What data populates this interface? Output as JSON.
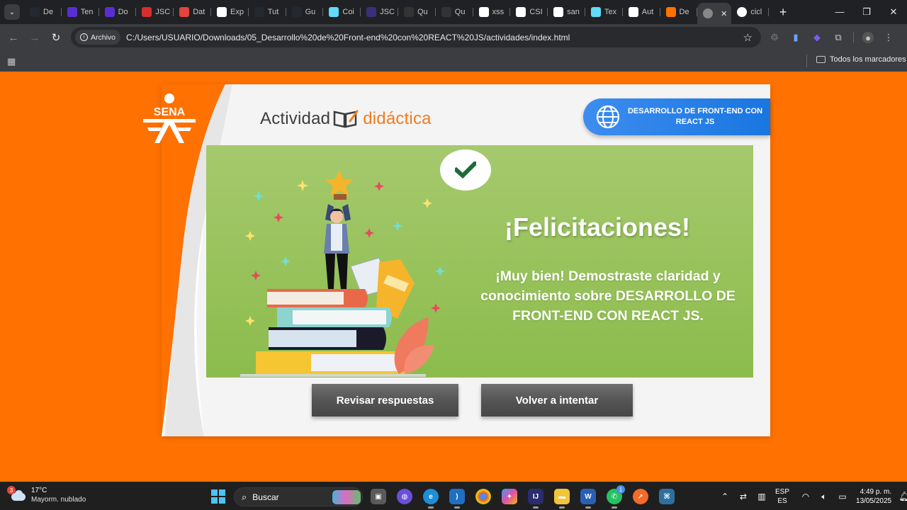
{
  "browser": {
    "tabs": [
      {
        "label": "De",
        "icon": "github-icon",
        "color": "#24292f"
      },
      {
        "label": "Ten",
        "icon": "quill-icon",
        "color": "#5a2fd1"
      },
      {
        "label": "Do",
        "icon": "quill-icon",
        "color": "#5a2fd1"
      },
      {
        "label": "JSC",
        "icon": "linkedin-learning-icon",
        "color": "#d62e2e"
      },
      {
        "label": "Dat",
        "icon": "laravel-icon",
        "color": "#e5443a"
      },
      {
        "label": "Exp",
        "icon": "angular-icon",
        "color": "#ffffff"
      },
      {
        "label": "Tut",
        "icon": "github-icon",
        "color": "#24292f"
      },
      {
        "label": "Gu",
        "icon": "github-icon",
        "color": "#24292f"
      },
      {
        "label": "Coi",
        "icon": "react-icon",
        "color": "#61dafb"
      },
      {
        "label": "JSC",
        "icon": "obs-icon",
        "color": "#3b2f7a"
      },
      {
        "label": "Qu",
        "icon": "book-icon",
        "color": "#333333"
      },
      {
        "label": "Qu",
        "icon": "book-icon",
        "color": "#333333"
      },
      {
        "label": "xss",
        "icon": "google-icon",
        "color": "#ffffff"
      },
      {
        "label": "CSI",
        "icon": "google-icon",
        "color": "#ffffff"
      },
      {
        "label": "san",
        "icon": "google-icon",
        "color": "#ffffff"
      },
      {
        "label": "Tex",
        "icon": "react-icon",
        "color": "#61dafb"
      },
      {
        "label": "Aut",
        "icon": "medium-icon",
        "color": "#ffffff"
      },
      {
        "label": "De",
        "icon": "sena-icon",
        "color": "#ff7100"
      }
    ],
    "active_tab": {
      "label": "",
      "icon": "globe-icon"
    },
    "last_tab": {
      "label": "cicl",
      "icon": "google-icon"
    },
    "new_tab": "+",
    "site_chip": "Archivo",
    "url": "C:/Users/USUARIO/Downloads/05_Desarrollo%20de%20Front-end%20con%20REACT%20JS/actividades/index.html",
    "bookmarks_label": "Todos los marcadores"
  },
  "activity": {
    "title_part1": "Actividad",
    "title_part2": "didáctica",
    "logo_text": "SENA",
    "course_badge": "DESARROLLO DE FRONT-END CON REACT JS",
    "heading": "¡Felicitaciones!",
    "message": "¡Muy bien! Demostraste claridad y conocimiento sobre DESARROLLO DE FRONT-END CON REACT JS.",
    "buttons": {
      "review": "Revisar respuestas",
      "retry": "Volver a intentar"
    }
  },
  "taskbar": {
    "weather_temp": "17°C",
    "weather_desc": "Mayorm. nublado",
    "weather_badge": "3",
    "search_placeholder": "Buscar",
    "whatsapp_badge": "1",
    "lang_top": "ESP",
    "lang_bottom": "ES",
    "time": "4:49 p. m.",
    "date": "13/05/2025"
  },
  "colors": {
    "background": "#ff7100",
    "panel": "#8cbc4c",
    "badge": "#1976e0",
    "button": "#555555"
  }
}
